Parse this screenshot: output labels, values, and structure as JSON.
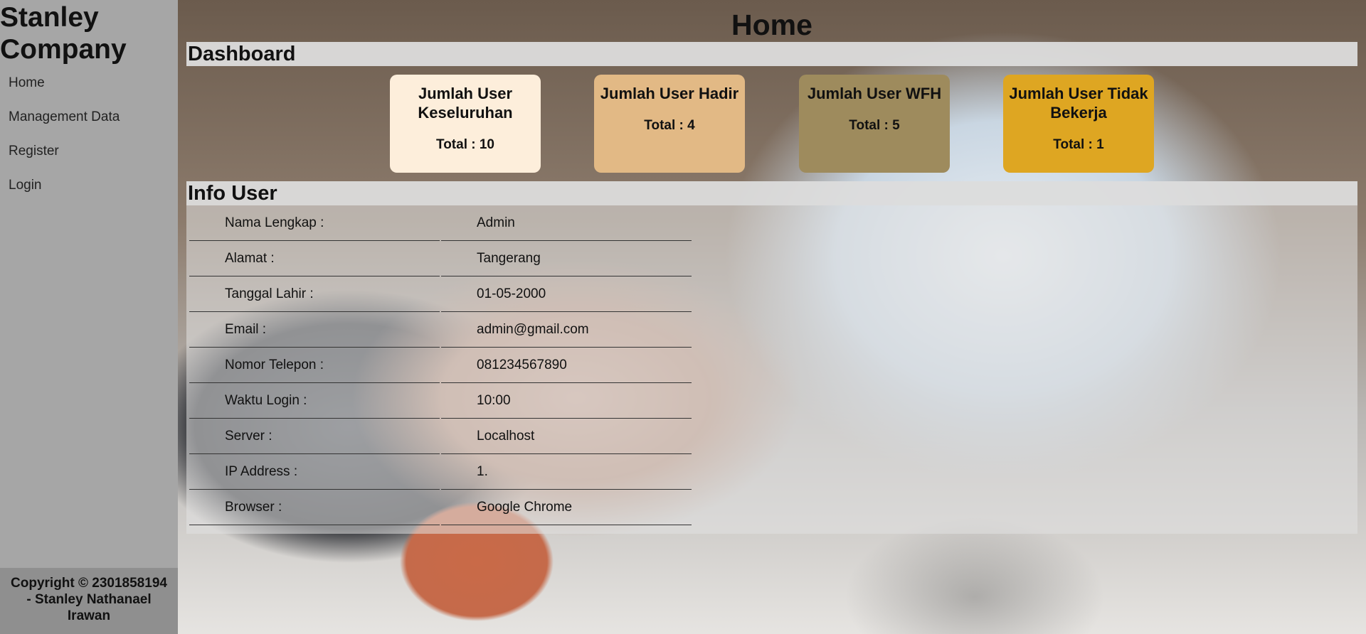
{
  "sidebar": {
    "brand": "Stanley Company",
    "items": [
      {
        "label": "Home"
      },
      {
        "label": "Management Data"
      },
      {
        "label": "Register"
      },
      {
        "label": "Login"
      }
    ],
    "footer": "Copyright © 2301858194 - Stanley Nathanael Irawan"
  },
  "header": {
    "title": "Home"
  },
  "dashboard": {
    "heading": "Dashboard",
    "cards": [
      {
        "title": "Jumlah User Keseluruhan",
        "total": "Total : 10",
        "color": "#fdeedb"
      },
      {
        "title": "Jumlah User Hadir",
        "total": "Total : 4",
        "color": "#e2b985"
      },
      {
        "title": "Jumlah User WFH",
        "total": "Total : 5",
        "color": "#9e8b5d"
      },
      {
        "title": "Jumlah User Tidak Bekerja",
        "total": "Total : 1",
        "color": "#dea622"
      }
    ]
  },
  "info": {
    "heading": "Info User",
    "rows": [
      {
        "label": "Nama Lengkap :",
        "value": "Admin"
      },
      {
        "label": "Alamat :",
        "value": "Tangerang"
      },
      {
        "label": "Tanggal Lahir :",
        "value": "01-05-2000"
      },
      {
        "label": "Email :",
        "value": "admin@gmail.com"
      },
      {
        "label": "Nomor Telepon :",
        "value": "081234567890"
      },
      {
        "label": "Waktu Login :",
        "value": "10:00"
      },
      {
        "label": "Server :",
        "value": "Localhost"
      },
      {
        "label": "IP Address :",
        "value": "1."
      },
      {
        "label": "Browser :",
        "value": "Google Chrome"
      }
    ]
  }
}
